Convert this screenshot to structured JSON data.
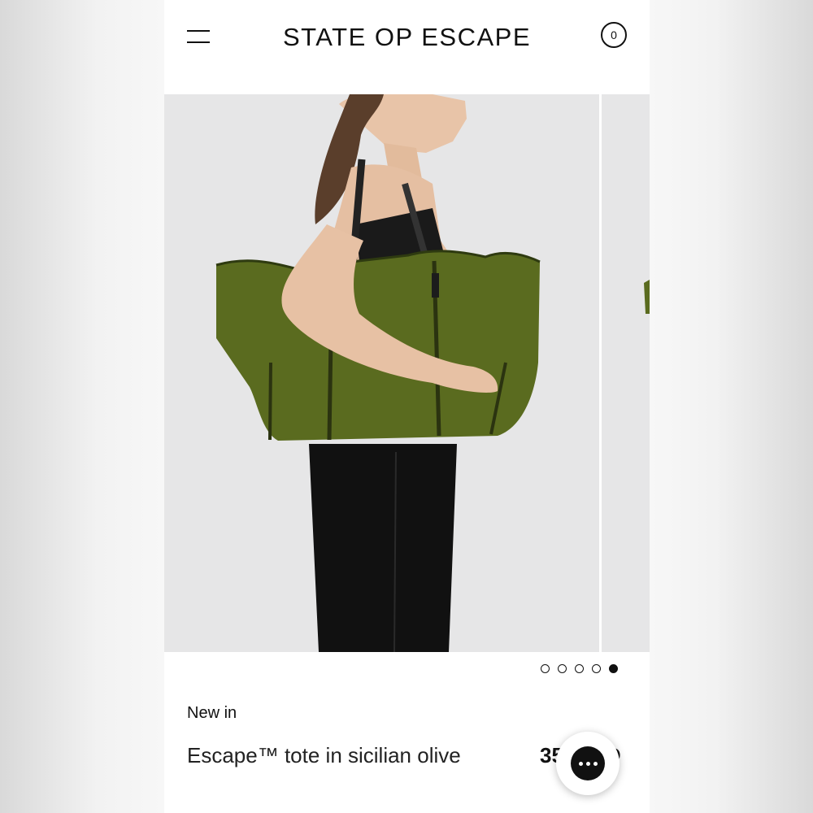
{
  "header": {
    "brand": "STATE OP ESCAPE",
    "cart_count": "0"
  },
  "gallery": {
    "slide_count": 5,
    "active_slide": 5
  },
  "product": {
    "badge": "New in",
    "title": "Escape™ tote in sicilian olive",
    "price_visible": "35",
    "price_suffix": "D"
  },
  "colors": {
    "bag": "#5a6b1f",
    "background": "#e6e6e7",
    "text": "#111111"
  },
  "icons": {
    "menu": "hamburger-menu",
    "cart": "cart-circle",
    "chat": "chat-bubble"
  }
}
